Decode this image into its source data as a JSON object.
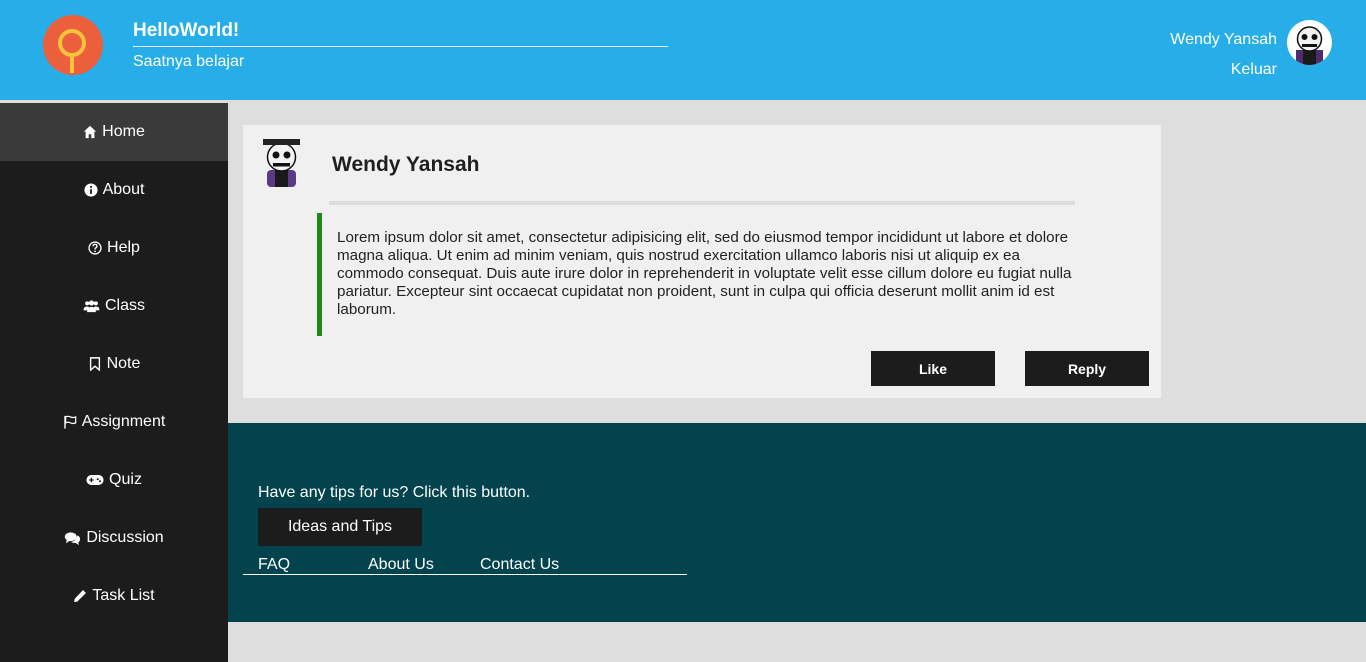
{
  "header": {
    "brand_title": "HelloWorld!",
    "brand_subtitle": "Saatnya belajar",
    "user_name": "Wendy Yansah",
    "logout": "Keluar"
  },
  "sidebar": {
    "items": [
      {
        "label": "Home",
        "icon": "home-icon"
      },
      {
        "label": "About",
        "icon": "info-icon"
      },
      {
        "label": "Help",
        "icon": "question-icon"
      },
      {
        "label": "Class",
        "icon": "users-icon"
      },
      {
        "label": "Note",
        "icon": "bookmark-icon"
      },
      {
        "label": "Assignment",
        "icon": "flag-icon"
      },
      {
        "label": "Quiz",
        "icon": "gamepad-icon"
      },
      {
        "label": "Discussion",
        "icon": "comments-icon"
      },
      {
        "label": "Task List",
        "icon": "pencil-icon"
      }
    ]
  },
  "post": {
    "author": "Wendy Yansah",
    "body": "Lorem ipsum dolor sit amet, consectetur adipisicing elit, sed do eiusmod tempor incididunt ut labore et dolore magna aliqua. Ut enim ad minim veniam, quis nostrud exercitation ullamco laboris nisi ut aliquip ex ea commodo consequat. Duis aute irure dolor in reprehenderit in voluptate velit esse cillum dolore eu fugiat nulla pariatur. Excepteur sint occaecat cupidatat non proident, sunt in culpa qui officia deserunt mollit anim id est laborum.",
    "like_label": "Like",
    "reply_label": "Reply"
  },
  "footer": {
    "tips_text": "Have any tips for us? Click this button.",
    "tips_button": "Ideas and Tips",
    "links": [
      "FAQ",
      "About Us",
      "Contact Us"
    ]
  },
  "colors": {
    "header": "#27aee8",
    "sidebar": "#1c1c1c",
    "footer": "#03434e",
    "quote_border": "#1e8a12"
  }
}
